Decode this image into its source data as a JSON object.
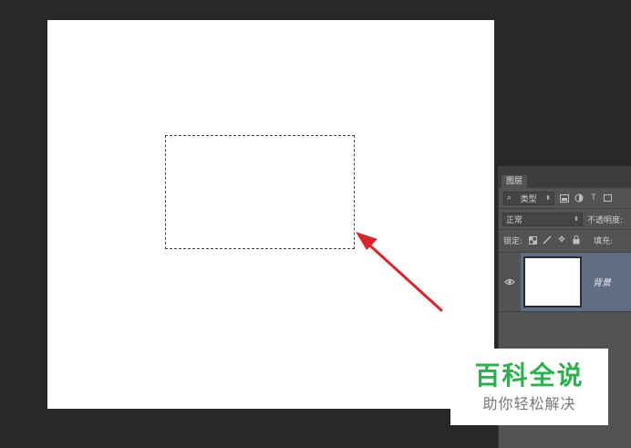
{
  "layers_panel": {
    "tab_label": "图层",
    "filter": {
      "kind_label": "类型",
      "icons": [
        "image-filter-icon",
        "adjustment-filter-icon",
        "type-filter-icon",
        "shape-filter-icon"
      ],
      "type_glyph": "T"
    },
    "blend_mode": "正常",
    "opacity_label": "不透明度:",
    "lock_label": "锁定:",
    "fill_label": "填充:",
    "layers": [
      {
        "name": "背景",
        "visible": true,
        "selected": true
      }
    ]
  },
  "watermark": {
    "title": "百科全说",
    "subtitle": "助你轻松解决"
  },
  "colors": {
    "workspace": "#282828",
    "panel": "#535353",
    "selected_layer": "#5f6e84",
    "arrow": "#d9262c",
    "watermark_green": "#2bb24c"
  }
}
